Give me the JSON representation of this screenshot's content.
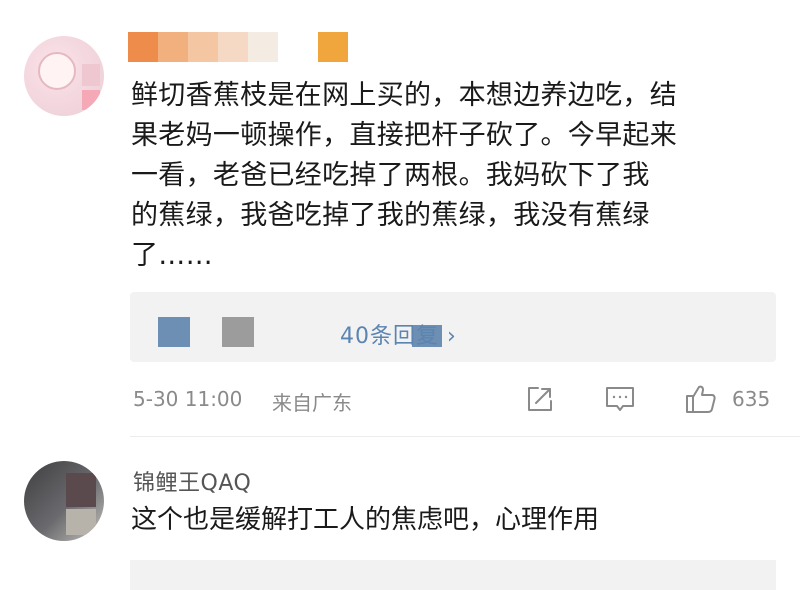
{
  "comments": [
    {
      "lines": [
        "鲜切香蕉枝是在网上买的，本想边养边吃，结",
        "果老妈一顿操作，直接把杆子砍了。今早起来",
        "一看，老爸已经吃掉了两根。我妈砍下了我",
        "的蕉绿，我爸吃掉了我的蕉绿，我没有蕉绿",
        "了……"
      ],
      "replies_label": "40条回复 ›",
      "date": "5-30 11:00",
      "location": "来自广东",
      "likes": "635",
      "icons": [
        "share-icon",
        "comment-icon",
        "thumbs-up-icon"
      ]
    },
    {
      "username": "锦鲤王QAQ",
      "text": "这个也是缓解打工人的焦虑吧，心理作用"
    }
  ],
  "colors": {
    "mosaic": [
      "#ee8c4b",
      "#f3b07f",
      "#f5c6a2",
      "#f5d9c4",
      "#f4ece3",
      "#ffffff",
      "#f0a63d"
    ],
    "reply_link": "#5b84b1",
    "meta": "#8a8a8a"
  }
}
